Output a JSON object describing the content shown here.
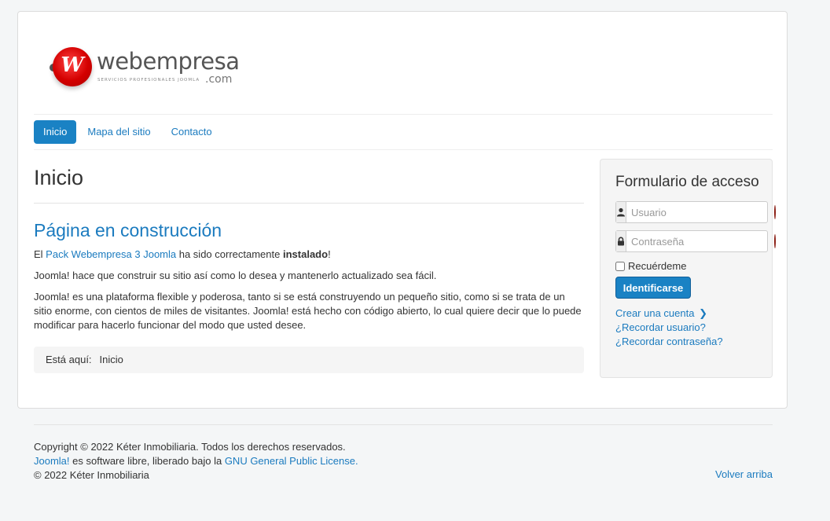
{
  "brand": {
    "name": "webempresa",
    "tagline": "SERVICIOS PROFESIONALES JOOMLA",
    "suffix": ".com"
  },
  "nav": {
    "items": [
      {
        "label": "Inicio",
        "active": true
      },
      {
        "label": "Mapa del sitio",
        "active": false
      },
      {
        "label": "Contacto",
        "active": false
      }
    ]
  },
  "page": {
    "heading": "Inicio",
    "article_title": "Página en construcción",
    "p1": {
      "prefix": "El ",
      "link": "Pack Webempresa 3 Joomla",
      "middle": " ha sido correctamente ",
      "bold": "instalado",
      "suffix": "!"
    },
    "p2": "Joomla! hace que construir su sitio así como lo desea y mantenerlo actualizado sea fácil.",
    "p3": "Joomla! es una plataforma flexible y poderosa, tanto si se está construyendo un pequeño sitio, como si se trata de un sitio enorme, con cientos de miles de visitantes. Joomla! está hecho con código abierto, lo cual quiere decir que lo puede modificar para hacerlo funcionar del modo que usted desee."
  },
  "breadcrumb": {
    "label": "Está aquí:",
    "current": "Inicio"
  },
  "login": {
    "title": "Formulario de acceso",
    "username_placeholder": "Usuario",
    "password_placeholder": "Contraseña",
    "remember_label": "Recuérdeme",
    "submit_label": "Identificarse",
    "links": {
      "create": "Crear una cuenta",
      "remind_user": "¿Recordar usuario?",
      "remind_pass": "¿Recordar contraseña?"
    }
  },
  "footer": {
    "copyright": "Copyright © 2022 Kéter Inmobiliaria. Todos los derechos reservados.",
    "joomla_link": "Joomla!",
    "license_text": " es software libre, liberado bajo la ",
    "license_link": "GNU General Public License.",
    "owner": "© 2022 Kéter Inmobiliaria",
    "back_to_top": "Volver arriba"
  },
  "colors": {
    "accent": "#1a82c4",
    "link": "#1b7bbf",
    "background": "#f4f6f7"
  },
  "icons": {
    "user": "user-icon",
    "lock": "lock-icon",
    "chevron": "chevron-right-icon",
    "field_badge": "password-manager-icon"
  }
}
